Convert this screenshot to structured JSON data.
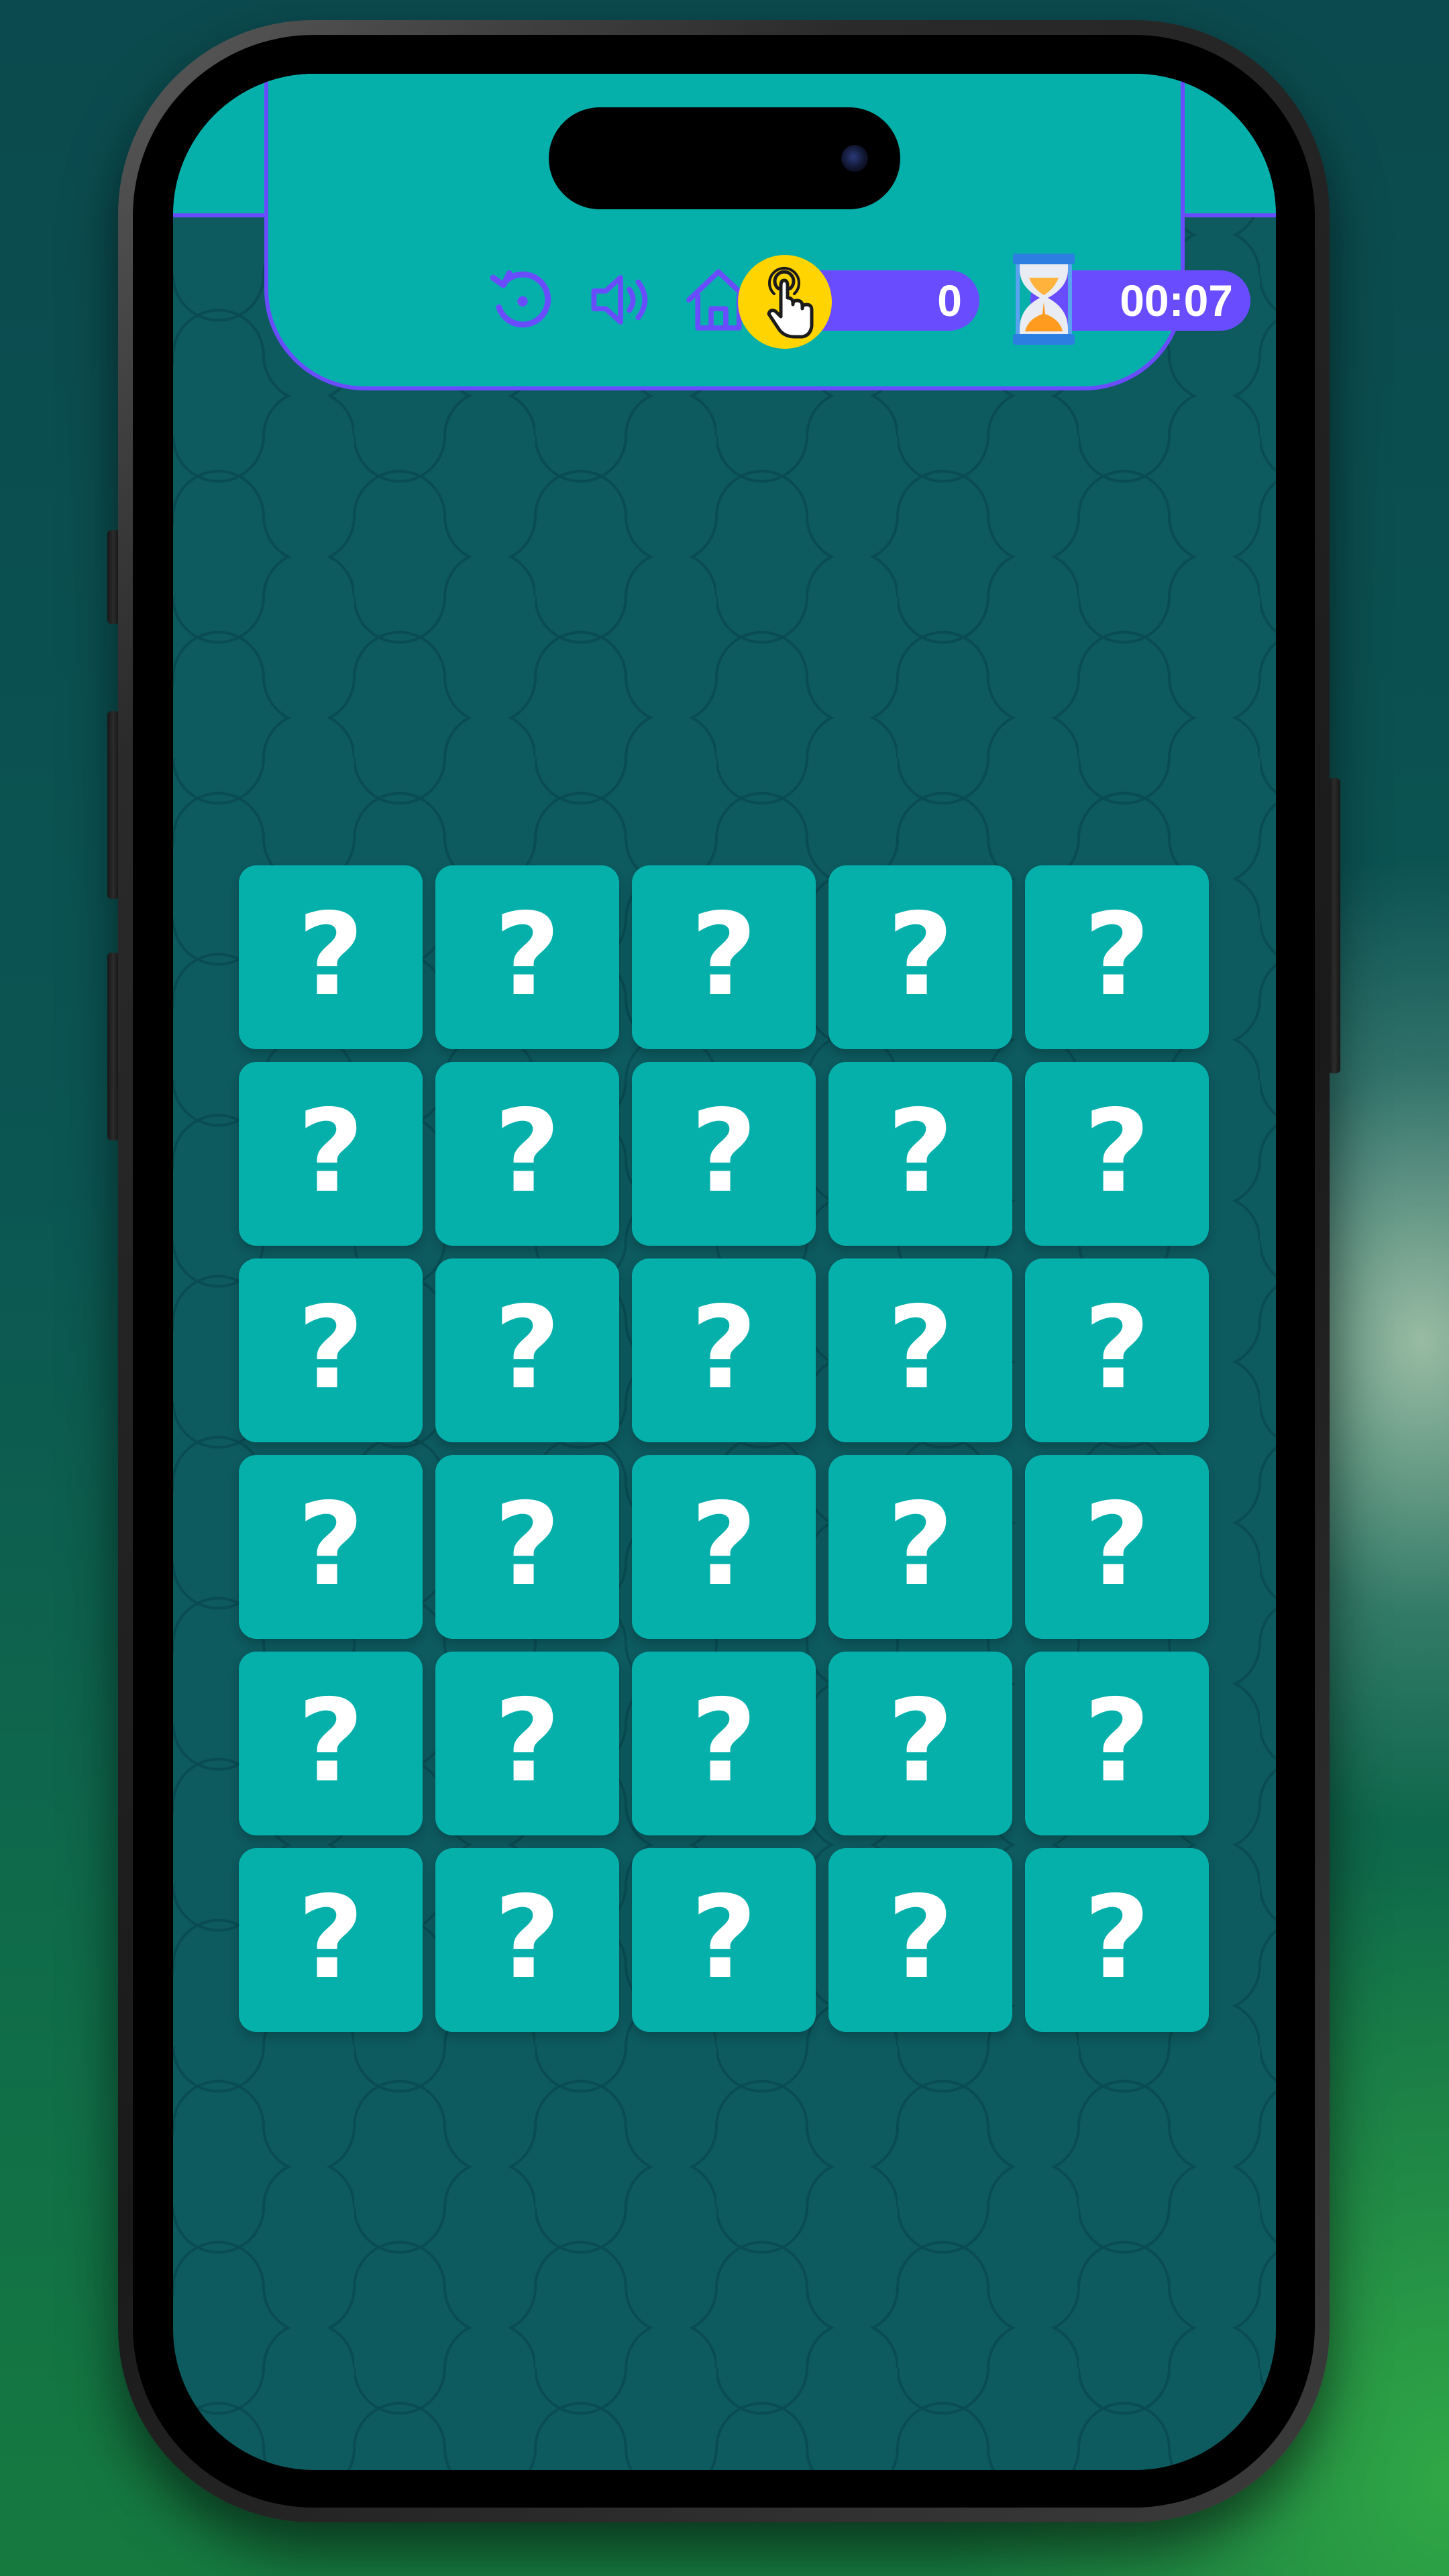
{
  "hud": {
    "controls": [
      {
        "name": "restart-button",
        "icon": "restart-icon"
      },
      {
        "name": "sound-button",
        "icon": "speaker-icon"
      },
      {
        "name": "home-button",
        "icon": "home-icon"
      }
    ],
    "moves": {
      "icon": "tap-hand-icon",
      "value": "0"
    },
    "timer": {
      "icon": "hourglass-icon",
      "value": "00:07"
    }
  },
  "board": {
    "rows": 6,
    "columns": 5,
    "cards": [
      {
        "face": "?"
      },
      {
        "face": "?"
      },
      {
        "face": "?"
      },
      {
        "face": "?"
      },
      {
        "face": "?"
      },
      {
        "face": "?"
      },
      {
        "face": "?"
      },
      {
        "face": "?"
      },
      {
        "face": "?"
      },
      {
        "face": "?"
      },
      {
        "face": "?"
      },
      {
        "face": "?"
      },
      {
        "face": "?"
      },
      {
        "face": "?"
      },
      {
        "face": "?"
      },
      {
        "face": "?"
      },
      {
        "face": "?"
      },
      {
        "face": "?"
      },
      {
        "face": "?"
      },
      {
        "face": "?"
      },
      {
        "face": "?"
      },
      {
        "face": "?"
      },
      {
        "face": "?"
      },
      {
        "face": "?"
      },
      {
        "face": "?"
      },
      {
        "face": "?"
      },
      {
        "face": "?"
      },
      {
        "face": "?"
      },
      {
        "face": "?"
      },
      {
        "face": "?"
      }
    ]
  },
  "colors": {
    "accent": "#6a4cff",
    "card": "#05b0ab",
    "background": "#0d5a5f",
    "coin": "#ffd400"
  }
}
